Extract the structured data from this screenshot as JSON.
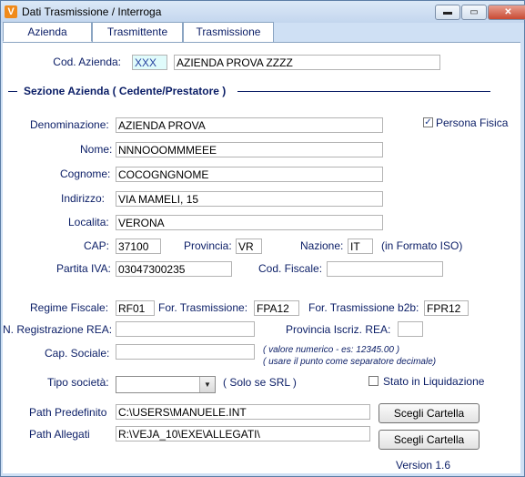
{
  "window": {
    "title": "Dati Trasmissione / Interroga",
    "app_icon": "V",
    "minimize_glyph": "▬",
    "maximize_glyph": "▭",
    "close_glyph": "✕"
  },
  "tabs": [
    {
      "label": "Azienda",
      "active": true
    },
    {
      "label": "Trasmittente",
      "active": false
    },
    {
      "label": "Trasmissione",
      "active": false
    }
  ],
  "form": {
    "cod_azienda": {
      "label": "Cod. Azienda:",
      "code": "XXX",
      "name": "AZIENDA PROVA ZZZZ"
    },
    "section_title": "Sezione Azienda ( Cedente/Prestatore )",
    "persona_fisica": {
      "label": "Persona Fisica",
      "checked": true,
      "mark": "✓"
    },
    "denominazione": {
      "label": "Denominazione:",
      "value": "AZIENDA PROVA"
    },
    "nome": {
      "label": "Nome:",
      "value": "NNNOOOMMMEEE"
    },
    "cognome": {
      "label": "Cognome:",
      "value": "COCOGNGNOME"
    },
    "indirizzo": {
      "label": "Indirizzo:",
      "value": "VIA MAMELI, 15"
    },
    "localita": {
      "label": "Localita:",
      "value": "VERONA"
    },
    "cap": {
      "label": "CAP:",
      "value": "37100"
    },
    "provincia": {
      "label": "Provincia:",
      "value": "VR"
    },
    "nazione": {
      "label": "Nazione:",
      "value": "IT",
      "hint": "(in Formato ISO)"
    },
    "partita_iva": {
      "label": "Partita IVA:",
      "value": "03047300235"
    },
    "cod_fiscale": {
      "label": "Cod. Fiscale:",
      "value": ""
    },
    "regime_fiscale": {
      "label": "Regime Fiscale:",
      "value": "RF01"
    },
    "for_trasmissione": {
      "label": "For. Trasmissione:",
      "value": "FPA12"
    },
    "for_trasmissione_b2b": {
      "label": "For. Trasmissione b2b:",
      "value": "FPR12"
    },
    "n_registrazione_rea": {
      "label": "N. Registrazione REA:",
      "value": ""
    },
    "provincia_iscriz_rea": {
      "label": "Provincia Iscriz. REA:",
      "value": ""
    },
    "cap_sociale": {
      "label": "Cap. Sociale:",
      "value": "",
      "hint_line1": "( valore numerico - es: 12345.00 )",
      "hint_line2": "( usare il punto come separatore decimale)"
    },
    "tipo_societa": {
      "label": "Tipo società:",
      "value": "",
      "hint": "( Solo se SRL )",
      "arrow": "▼"
    },
    "stato_liquidazione": {
      "label": "Stato in Liquidazione",
      "checked": false
    },
    "path_predefinito": {
      "label": "Path Predefinito",
      "value": "C:\\USERS\\MANUELE.INT"
    },
    "path_allegati": {
      "label": "Path Allegati",
      "value": "R:\\VEJA_10\\EXE\\ALLEGATI\\"
    },
    "scegli_cartella_1": "Scegli Cartella",
    "scegli_cartella_2": "Scegli Cartella",
    "version": "Version 1.6"
  }
}
